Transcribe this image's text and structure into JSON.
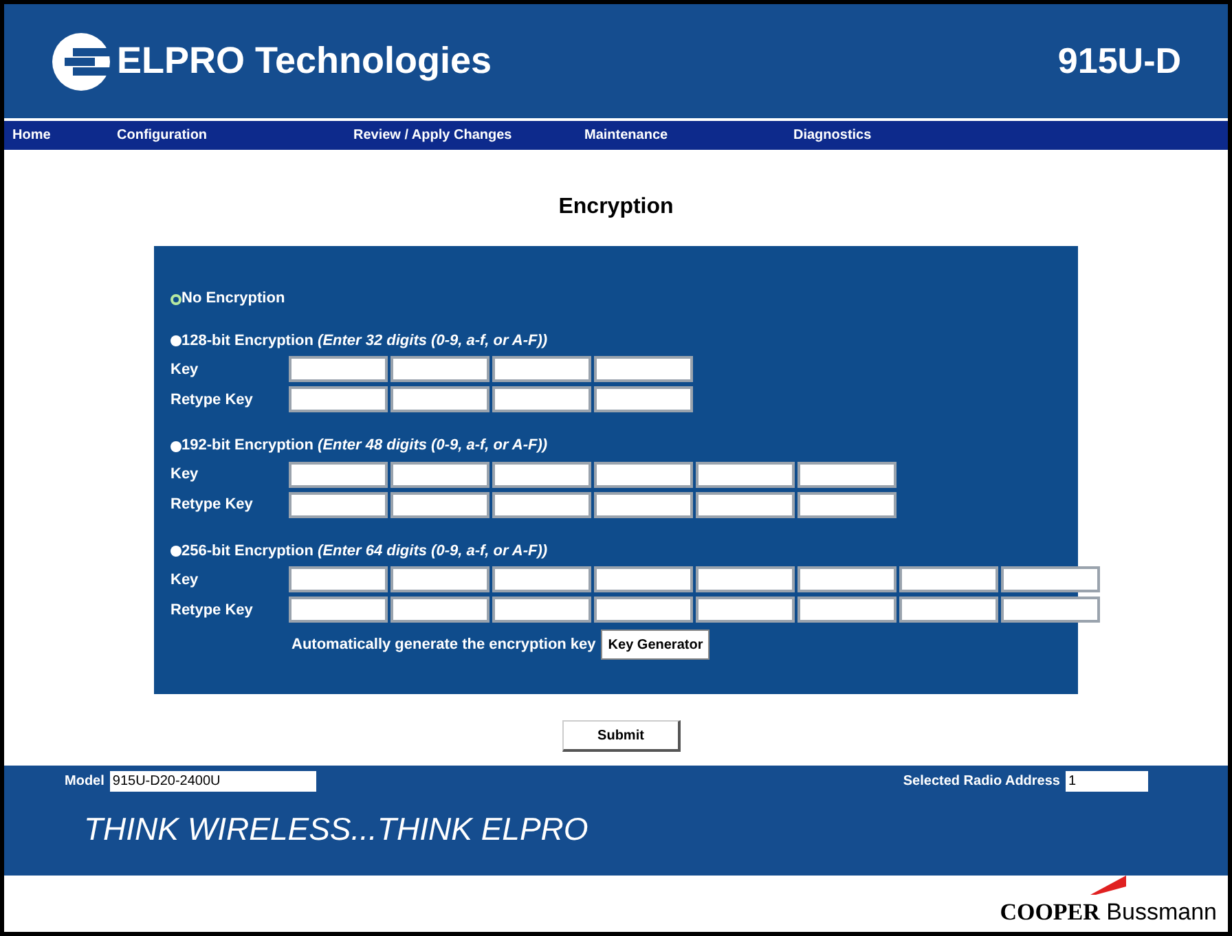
{
  "header": {
    "brand": "ELPRO Technologies",
    "product": "915U-D"
  },
  "nav": [
    {
      "label": "Home"
    },
    {
      "label": "Configuration"
    },
    {
      "label": "Review / Apply Changes"
    },
    {
      "label": "Maintenance"
    },
    {
      "label": "Diagnostics"
    }
  ],
  "page_title": "Encryption",
  "encryption_options": [
    {
      "label": "No Encryption",
      "selected": true
    },
    {
      "label": "128-bit Encryption",
      "hint": "(Enter 32 digits (0-9, a-f, or A-F))",
      "selected": false,
      "key_label": "Key",
      "retype_label": "Retype Key",
      "key_fields": [
        {
          "disabled": false
        },
        {
          "disabled": false
        },
        {
          "disabled": false
        },
        {
          "disabled": false
        }
      ]
    },
    {
      "label": "192-bit Encryption",
      "hint": "(Enter 48 digits (0-9, a-f, or A-F))",
      "selected": false,
      "key_label": "Key",
      "retype_label": "Retype Key",
      "key_fields": [
        {
          "disabled": false
        },
        {
          "disabled": false
        },
        {
          "disabled": false
        },
        {
          "disabled": false
        },
        {
          "disabled": false
        },
        {
          "disabled": false
        }
      ]
    },
    {
      "label": "256-bit Encryption",
      "hint": "(Enter 64 digits (0-9, a-f, or A-F))",
      "selected": false,
      "key_label": "Key",
      "retype_label": "Retype Key",
      "key_fields": [
        {
          "disabled": false
        },
        {
          "disabled": false
        },
        {
          "disabled": false
        },
        {
          "disabled": false
        },
        {
          "disabled": false
        },
        {
          "disabled": false
        },
        {
          "disabled": false
        },
        {
          "disabled": false
        }
      ]
    }
  ],
  "key_generator": {
    "text": "Automatically generate the encryption key",
    "button": "Key Generator"
  },
  "submit": "Submit",
  "footer": {
    "model_label": "Model",
    "model_value": "915U-D20-2400U",
    "address_label": "Selected Radio Address",
    "address_value": "1",
    "tagline": "THINK WIRELESS...THINK ELPRO",
    "logo_bold": "COOPER",
    "logo_rest": "Bussmann"
  }
}
